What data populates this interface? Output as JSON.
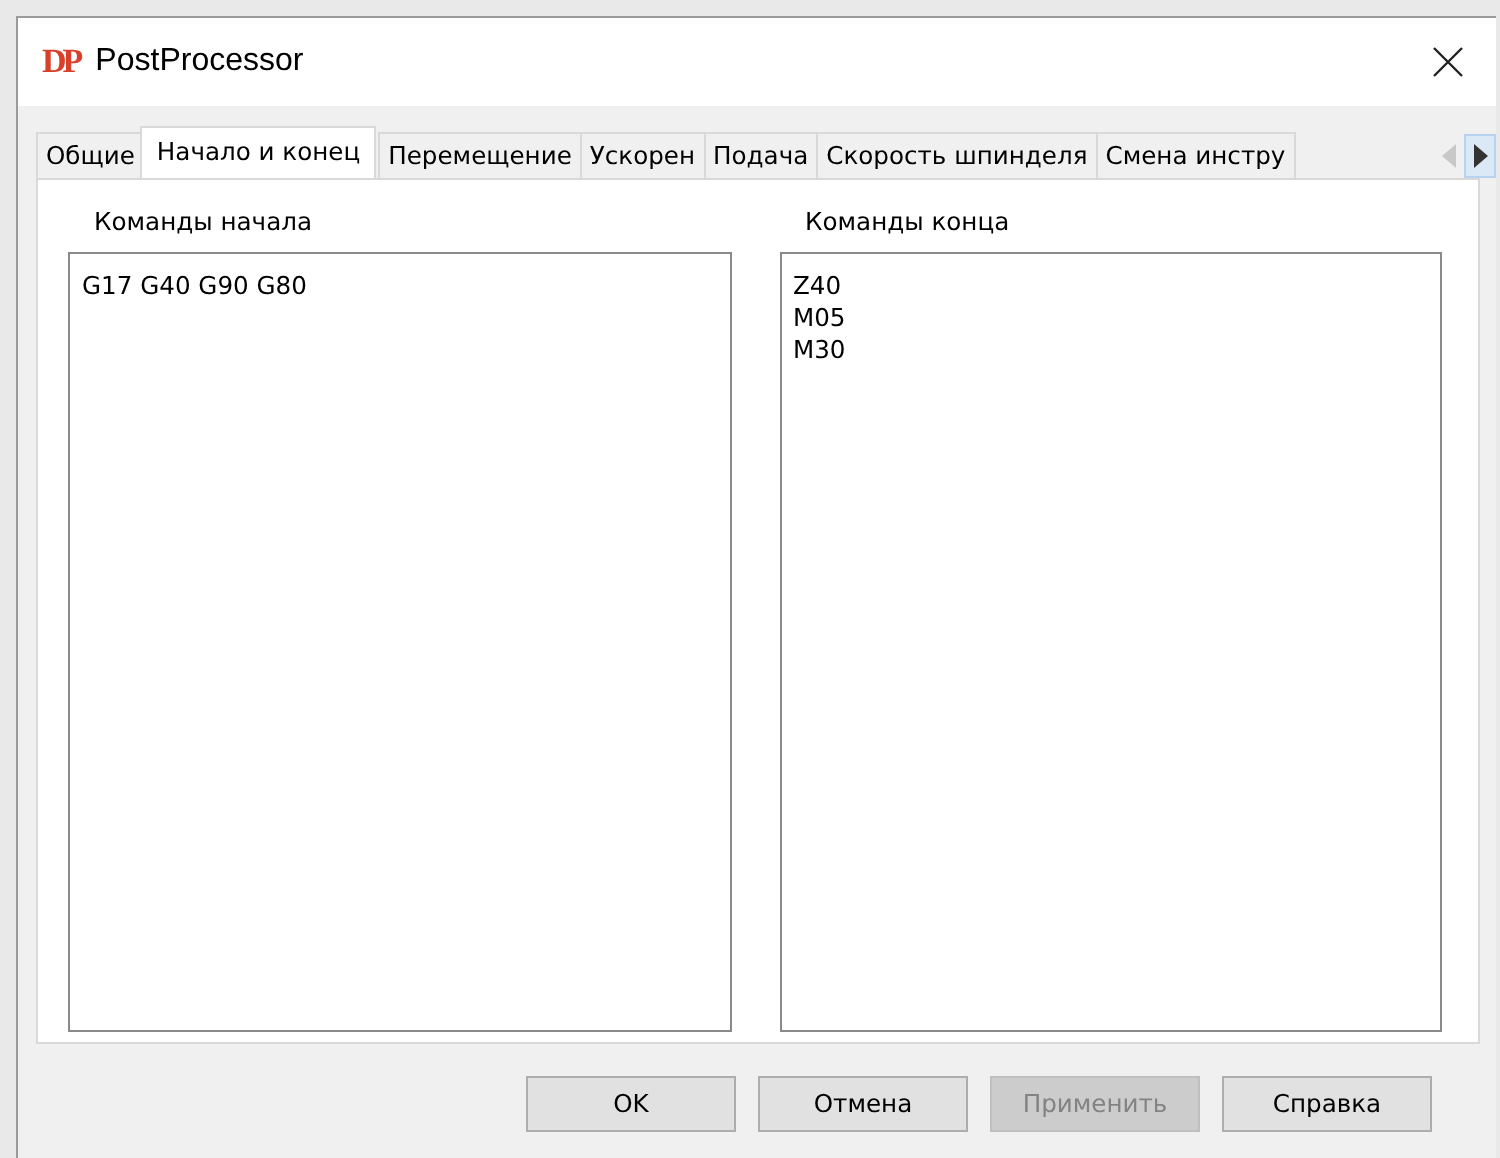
{
  "window": {
    "title": "PostProcessor",
    "logo": "DP"
  },
  "tabs": [
    {
      "label": "Общие",
      "selected": false
    },
    {
      "label": "Начало и конец",
      "selected": true
    },
    {
      "label": "Перемещение",
      "selected": false
    },
    {
      "label": "Ускорен",
      "selected": false
    },
    {
      "label": "Подача",
      "selected": false
    },
    {
      "label": "Скорость шпинделя",
      "selected": false
    },
    {
      "label": "Смена инстру",
      "selected": false
    }
  ],
  "tab_scroll": {
    "left_disabled": true,
    "right_hover": true
  },
  "panels": [
    {
      "label": "Команды начала",
      "lines": [
        "G17 G40 G90 G80"
      ]
    },
    {
      "label": "Команды конца",
      "lines": [
        "Z40",
        "M05",
        "M30"
      ]
    }
  ],
  "buttons": [
    {
      "label": "OK",
      "disabled": false
    },
    {
      "label": "Отмена",
      "disabled": false
    },
    {
      "label": "Применить",
      "disabled": true
    },
    {
      "label": "Справка",
      "disabled": false
    }
  ]
}
